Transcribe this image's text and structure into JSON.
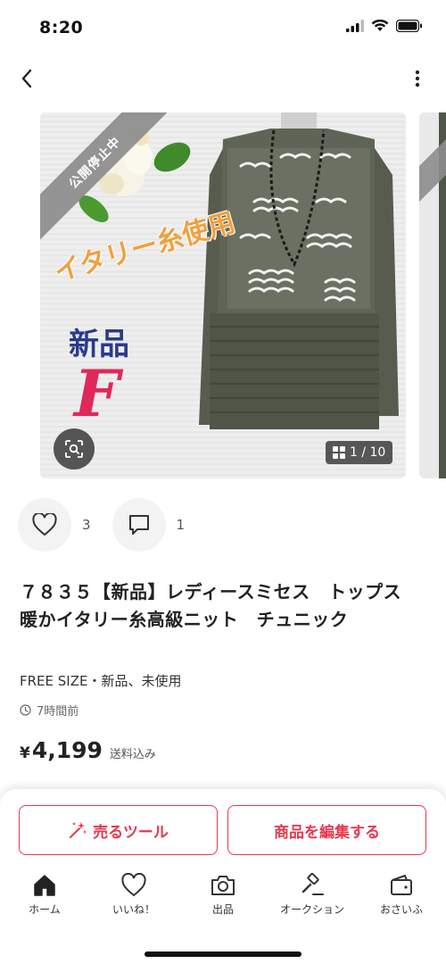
{
  "status": {
    "time": "8:20"
  },
  "carousel": {
    "ribbon_label": "公開停止中",
    "overlay_italy": "イタリー糸使用",
    "overlay_new": "新品",
    "overlay_size": "F",
    "page_counter": "1 / 10"
  },
  "social": {
    "likes_count": "3",
    "comments_count": "1"
  },
  "item": {
    "title": "７８３５【新品】レディースミセス　トップス　暖かイタリー糸高級ニット　チュニック",
    "condition": "FREE SIZE・新品、未使用",
    "time_ago": "7時間前",
    "price_yen": "¥",
    "price": "4,199",
    "shipping": "送料込み"
  },
  "actions": {
    "sell_tool": "売るツール",
    "edit_item": "商品を編集する"
  },
  "tabs": [
    {
      "label": "ホーム",
      "icon": "home-icon"
    },
    {
      "label": "いいね！",
      "icon": "heart-icon"
    },
    {
      "label": "出品",
      "icon": "camera-icon"
    },
    {
      "label": "オークション",
      "icon": "gavel-icon"
    },
    {
      "label": "おさいふ",
      "icon": "wallet-icon"
    }
  ],
  "colors": {
    "accent": "#e8384f",
    "ribbon": "#8d8d8d"
  }
}
